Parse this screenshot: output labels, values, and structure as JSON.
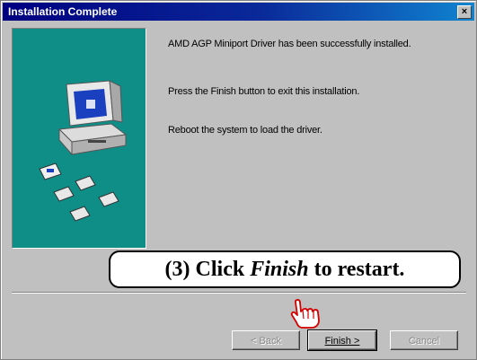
{
  "window": {
    "title": "Installation Complete",
    "close_glyph": "×"
  },
  "messages": [
    "AMD AGP Miniport Driver has been successfully installed.",
    "Press the Finish button to exit this installation.",
    "Reboot the system to load the driver."
  ],
  "callout": {
    "prefix": "(3)  Click ",
    "emphasis": "Finish",
    "suffix": " to restart."
  },
  "buttons": {
    "back": "< Back",
    "finish": "Finish >",
    "cancel": "Cancel"
  },
  "colors": {
    "panel_teal": "#0f8d87",
    "title_blue": "#000080"
  },
  "icons": [
    "computer-icon",
    "disk-icon",
    "pointing-hand-icon",
    "close-icon"
  ]
}
